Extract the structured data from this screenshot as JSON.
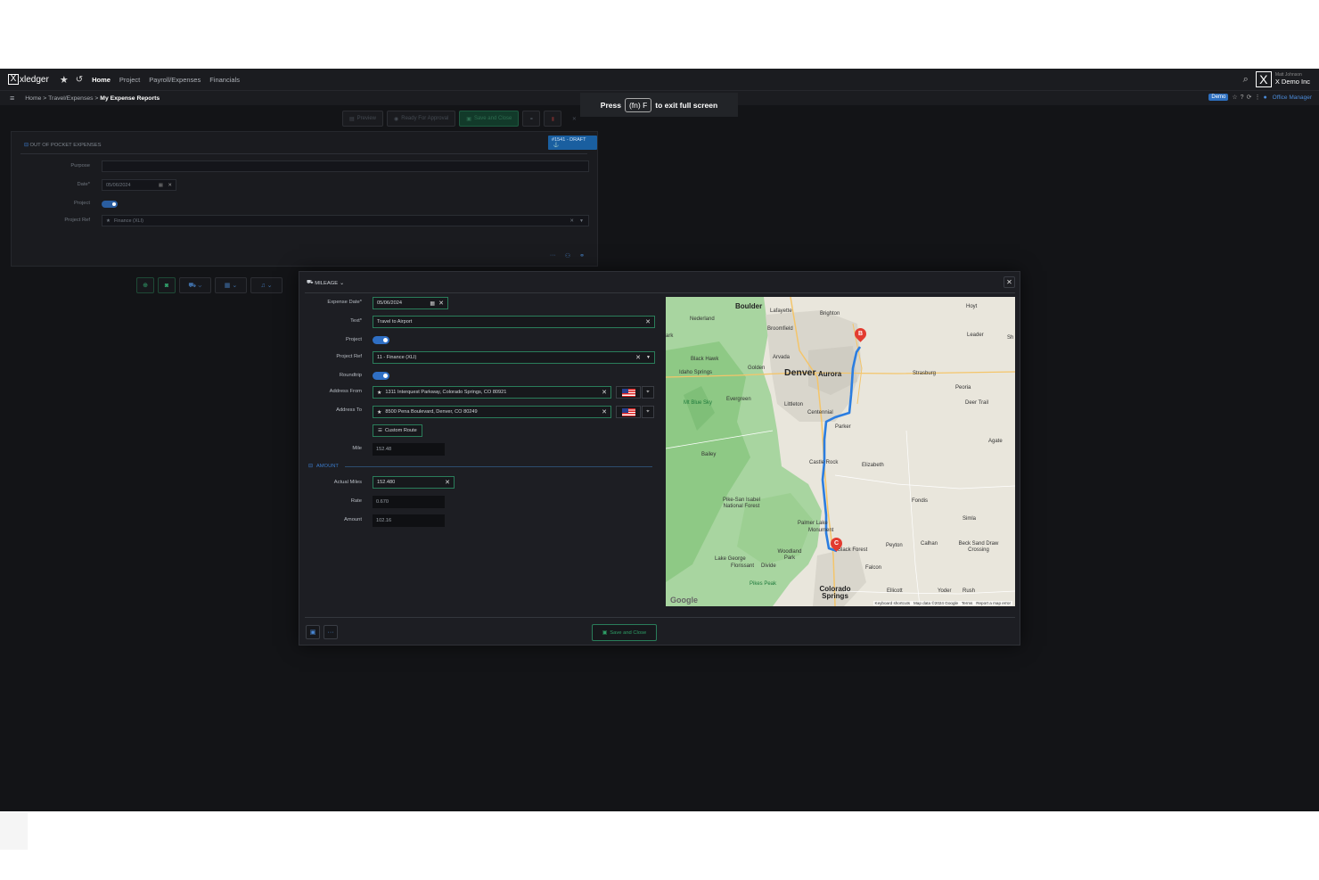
{
  "topbar": {
    "logo": "xledger",
    "nav": [
      "Home",
      "Project",
      "Payroll/Expenses",
      "Financials"
    ],
    "user_name": "Matt Johnson",
    "company": "X Demo Inc",
    "icons": [
      "star-icon",
      "history-icon",
      "search-icon"
    ]
  },
  "breadcrumb": {
    "items": [
      "Home",
      "Travel/Expenses"
    ],
    "current": "My Expense Reports",
    "demo_badge": "Demo",
    "role": "Office Manager"
  },
  "toast": {
    "before": "Press",
    "key": "(fn) F",
    "after": "to exit full screen"
  },
  "actionbar": {
    "preview": "Preview",
    "ready_for_approval": "Ready For Approval",
    "save_and_close": "Save and Close"
  },
  "bg_form": {
    "section_title": "OUT OF POCKET EXPENSES",
    "draft_badge": "#1541 - DRAFT",
    "labels": {
      "purpose": "Purpose",
      "date": "Date*",
      "project": "Project",
      "project_ref": "Project Ref"
    },
    "date_value": "05/06/2024",
    "project_ref_value": "Finance (XLI)"
  },
  "modal": {
    "title": "MILEAGE",
    "labels": {
      "expense_date": "Expense Date*",
      "text": "Text*",
      "project": "Project",
      "project_ref": "Project Ref",
      "roundtrip": "Roundtrip",
      "address_from": "Address From",
      "address_to": "Address To",
      "mile": "Mile",
      "actual_miles": "Actual Miles",
      "rate": "Rate",
      "amount": "Amount"
    },
    "values": {
      "expense_date": "05/06/2024",
      "text": "Travel to Airport",
      "project_ref": "11 - Finance (XLI)",
      "address_from": "1311 Interquest Parkway, Colorado Springs, CO 80921",
      "address_to": "8500 Pena Boulevard, Denver, CO 80249",
      "mile": "152.48",
      "actual_miles": "152.480",
      "rate": "0.670",
      "amount": "102.16"
    },
    "custom_route": "Custom Route",
    "amount_section": "AMOUNT",
    "save_and_close": "Save and Close",
    "toggles": {
      "project": true,
      "roundtrip": true
    }
  },
  "map": {
    "labels": {
      "boulder": "Boulder",
      "lafayette": "Lafayette",
      "brighton": "Brighton",
      "hoyt": "Hoyt",
      "nederland": "Nederland",
      "broomfield": "Broomfield",
      "leader": "Leader",
      "sh": "Sh",
      "black_hawk": "Black Hawk",
      "arvada": "Arvada",
      "idaho_springs": "Idaho Springs",
      "golden": "Golden",
      "denver": "Denver",
      "aurora": "Aurora",
      "strasburg": "Strasburg",
      "peoria": "Peoria",
      "mt_blue_sky": "Mt Blue Sky",
      "evergreen": "Evergreen",
      "littleton": "Littleton",
      "centennial": "Centennial",
      "deer_trail": "Deer Trail",
      "parker": "Parker",
      "agate": "Agate",
      "bailey": "Bailey",
      "castle_rock": "Castle Rock",
      "elizabeth": "Elizabeth",
      "fondis": "Fondis",
      "pike_san_isabel": "Pike-San Isabel National Forest",
      "simla": "Simla",
      "palmer_lake": "Palmer Lake",
      "monument": "Monument",
      "woodland_park": "Woodland Park",
      "black_forest": "Black Forest",
      "peyton": "Peyton",
      "calhan": "Calhan",
      "beck_sand": "Beck Sand Draw Crossing",
      "lake_george": "Lake George",
      "florissant": "Florissant",
      "divide": "Divide",
      "falcon": "Falcon",
      "pikes_peak": "Pikes Peak",
      "colorado_springs": "Colorado Springs",
      "ellicott": "Ellicott",
      "yoder": "Yoder",
      "rush": "Rush",
      "ark": "ark"
    },
    "google": "Google",
    "footer": {
      "shortcuts": "Keyboard shortcuts",
      "data": "Map data ©2024 Google",
      "terms": "Terms",
      "report": "Report a map error"
    },
    "markers": [
      "B",
      "C"
    ]
  }
}
